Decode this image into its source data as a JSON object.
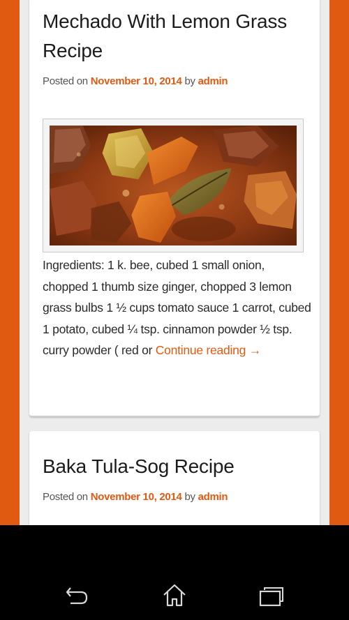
{
  "posts": [
    {
      "title": "Mechado With Lemon Grass Recipe",
      "meta_prefix": "Posted on",
      "date": "November 10, 2014",
      "meta_by": "by",
      "author": "admin",
      "image_icon": "food-photo-icon",
      "excerpt": "Ingredients: 1 k. bee, cubed 1 small onion, chopped 1 thumb size ginger, chopped 3 lemon grass bulbs 1 ½ cups tomato sauce 1 carrot, cubed 1 potato, cubed ¼ tsp. cinnamon powder ½ tsp. curry powder ( red or",
      "continue_label": "Continue reading →"
    },
    {
      "title": "Baka Tula-Sog Recipe",
      "meta_prefix": "Posted on",
      "date": "November 10, 2014",
      "meta_by": "by",
      "author": "admin"
    }
  ],
  "navbar": {
    "back_icon": "back-icon",
    "home_icon": "home-icon",
    "recents_icon": "recent-apps-icon"
  },
  "colors": {
    "accent": "#e05a12",
    "page_background": "#ececec",
    "card": "#ffffff",
    "navbar": "#000000"
  }
}
